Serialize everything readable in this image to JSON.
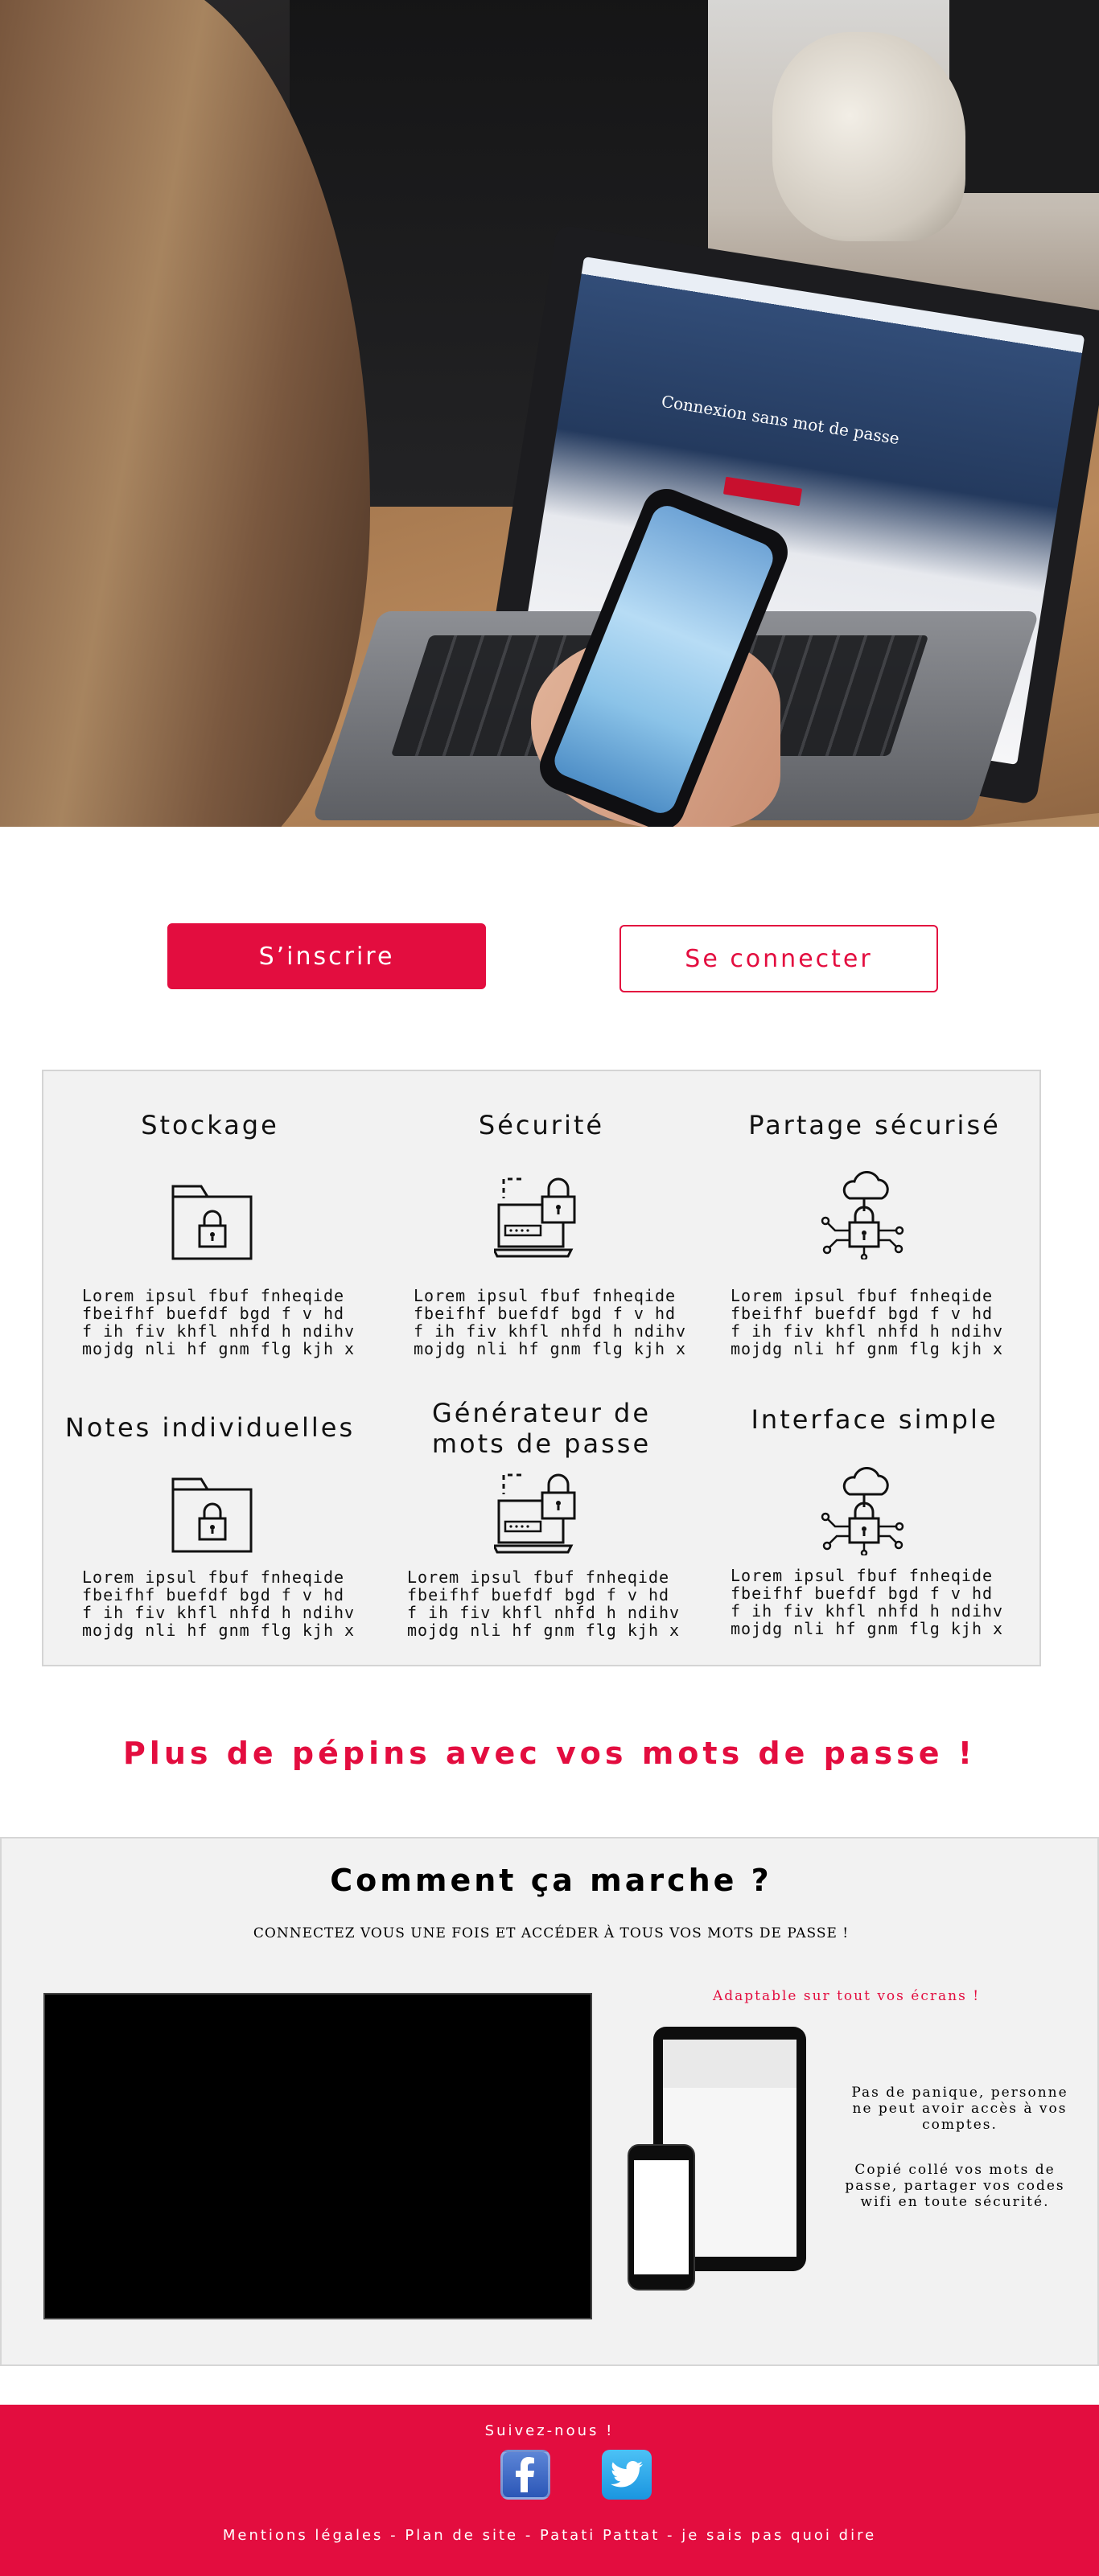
{
  "buttons": {
    "signup": "S’inscrire",
    "login": "Se connecter"
  },
  "features": [
    {
      "title": "Stockage",
      "icon": "folder-lock-icon",
      "desc": [
        "Lorem ipsul fbuf fnheqide",
        "fbeifhf buefdf bgd f v hd",
        "f ih fiv khfl nhfd h  ndihv",
        "mojdg nli hf gnm flg kjh x"
      ]
    },
    {
      "title": "Sécurité",
      "icon": "laptop-lock-icon",
      "desc": [
        "Lorem ipsul fbuf fnheqide",
        "fbeifhf buefdf bgd f v hd",
        "f ih fiv khfl nhfd h  ndihv",
        "mojdg nli hf gnm flg kjh x"
      ]
    },
    {
      "title": "Partage sécurisé",
      "icon": "cloud-lock-network-icon",
      "desc": [
        "Lorem ipsul fbuf fnheqide",
        "fbeifhf buefdf bgd f v hd",
        "f ih fiv khfl nhfd h  ndihv",
        "mojdg nli hf gnm flg kjh x"
      ]
    },
    {
      "title": "Notes individuelles",
      "icon": "folder-lock-icon",
      "desc": [
        "Lorem ipsul fbuf fnheqide",
        "fbeifhf buefdf bgd f v hd",
        "f ih fiv khfl nhfd h  ndihv",
        "mojdg nli hf gnm flg kjh x"
      ]
    },
    {
      "title_lines": [
        "Générateur de",
        "mots de passe"
      ],
      "icon": "laptop-lock-icon",
      "desc": [
        "Lorem ipsul fbuf fnheqide",
        "fbeifhf buefdf bgd f v hd",
        "f ih fiv khfl nhfd h  ndihv",
        "mojdg nli hf gnm flg kjh x"
      ]
    },
    {
      "title": "Interface simple",
      "icon": "cloud-lock-network-icon",
      "desc": [
        "Lorem ipsul fbuf fnheqide",
        "fbeifhf buefdf bgd f v hd",
        "f ih fiv khfl nhfd h  ndihv",
        "mojdg nli hf gnm flg kjh x"
      ]
    }
  ],
  "tagline": "Plus de pépins avec vos mots de passe !",
  "how": {
    "title": "Comment ça marche ?",
    "subtitle": "CONNECTEZ VOUS UNE FOIS ET ACCÉDER À TOUS VOS MOTS DE PASSE !",
    "adaptable": "Adaptable sur tout vos écrans !",
    "text1": [
      "Pas de panique, personne",
      "ne peut avoir accès à vos",
      "comptes."
    ],
    "text2": [
      "Copié collé vos mots de",
      "passe, partager vos codes",
      "wifi en toute sécurité."
    ]
  },
  "hero_screen": {
    "title": "Connexion sans mot de passe"
  },
  "footer": {
    "follow": "Suivez-nous !",
    "links": "Mentions légales - Plan de site - Patati Pattat - je sais pas quoi dire"
  },
  "colors": {
    "accent": "#e30d3f",
    "panel": "#f2f2f2"
  }
}
